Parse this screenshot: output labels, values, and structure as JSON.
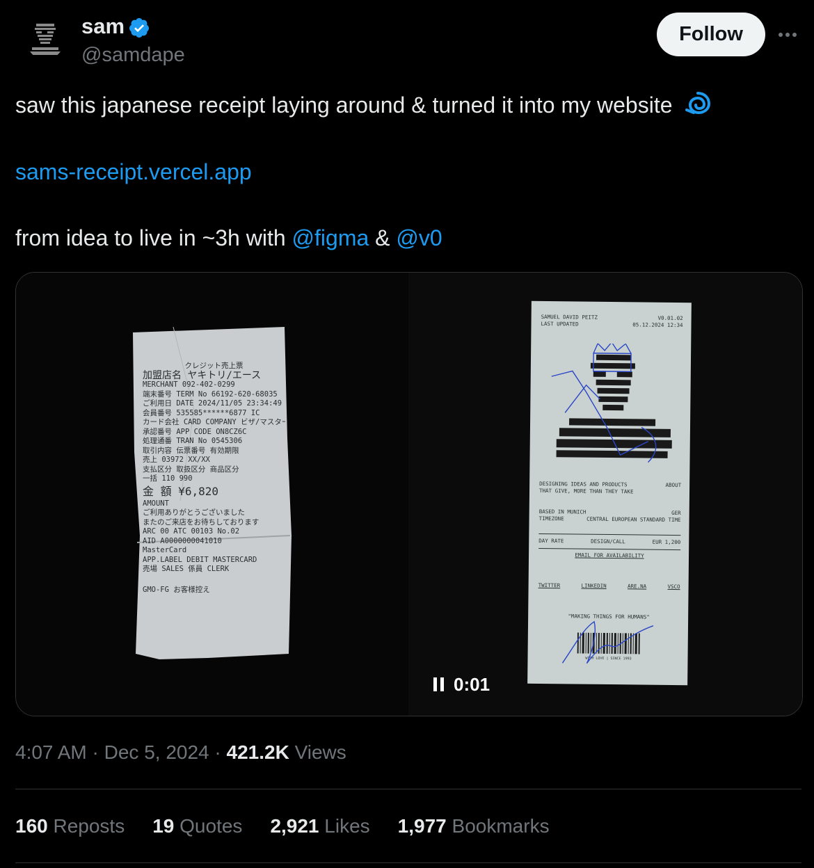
{
  "author": {
    "name": "sam",
    "handle": "@samdape",
    "follow_label": "Follow"
  },
  "tweet": {
    "line1": "saw this japanese receipt laying around & turned it into my website",
    "link": "sams-receipt.vercel.app",
    "line3_prefix": "from idea to live in ~3h with ",
    "mention1": "@figma",
    "line3_mid": " & ",
    "mention2": "@v0"
  },
  "video": {
    "time": "0:01"
  },
  "receipt_left": {
    "lines": [
      "クレジット売上票",
      "加盟店名 ヤキトリ/エース",
      "MERCHANT 092-402-0299",
      "端末番号 TERM No 66192-620-68035",
      "ご利用日 DATE 2024/11/05 23:34:49",
      "会員番号 535585******6877 IC",
      "カード会社 CARD COMPANY ビザ/マスター",
      "承認番号 APP CODE ON8CZ6C",
      "処理通番 TRAN No 0545306",
      "取引内容 伝票番号 有効期限",
      "売上 03972 XX/XX",
      "支払区分 取扱区分 商品区分",
      "一括 110 990",
      "金 額 ¥6,820",
      "AMOUNT",
      "ご利用ありがとうございました",
      "またのご来店をお待ちしております",
      "ARC 00 ATC 00103 No.02",
      "AID A0000000041010",
      "MasterCard",
      "APP.LABEL DEBIT MASTERCARD",
      "売場 SALES 係員 CLERK",
      "GMO-FG お客様控え"
    ]
  },
  "receipt_right": {
    "header_name": "SAMUEL DAVID PEITZ",
    "version": "V0.01.02",
    "last_updated": "LAST UPDATED",
    "date": "05.12.2024 12:34",
    "tagline1": "DESIGNING IDEAS AND PRODUCTS",
    "tagline2": "THAT GIVE, MORE THAN THEY TAKE",
    "tag_about": "ABOUT",
    "based": "BASED IN MUNICH",
    "based_code": "GER",
    "timezone": "TIMEZONE",
    "timezone_val": "CENTRAL EUROPEAN STANDARD TIME",
    "col_rate": "DAY RATE",
    "col_design": "DESIGN/CALL",
    "col_eur": "EUR 1,200",
    "email": "EMAIL FOR AVAILABILITY",
    "links": [
      "TWITTER",
      "LINKEDIN",
      "ARE.NA",
      "VSCO"
    ],
    "motto": "\"MAKING THINGS FOR HUMANS\"",
    "barcode_caption": "WITH LOVE | SINCE 1993"
  },
  "meta": {
    "time": "4:07 AM",
    "sep1": " · ",
    "date": "Dec 5, 2024",
    "sep2": " · ",
    "views_count": "421.2K",
    "views_label": " Views"
  },
  "stats": [
    {
      "count": "160",
      "label": " Reposts"
    },
    {
      "count": "19",
      "label": " Quotes"
    },
    {
      "count": "2,921",
      "label": " Likes"
    },
    {
      "count": "1,977",
      "label": " Bookmarks"
    }
  ],
  "colors": {
    "accent": "#1d9bf0",
    "background": "#000000",
    "text": "#e7e9ea",
    "muted": "#71767b"
  }
}
